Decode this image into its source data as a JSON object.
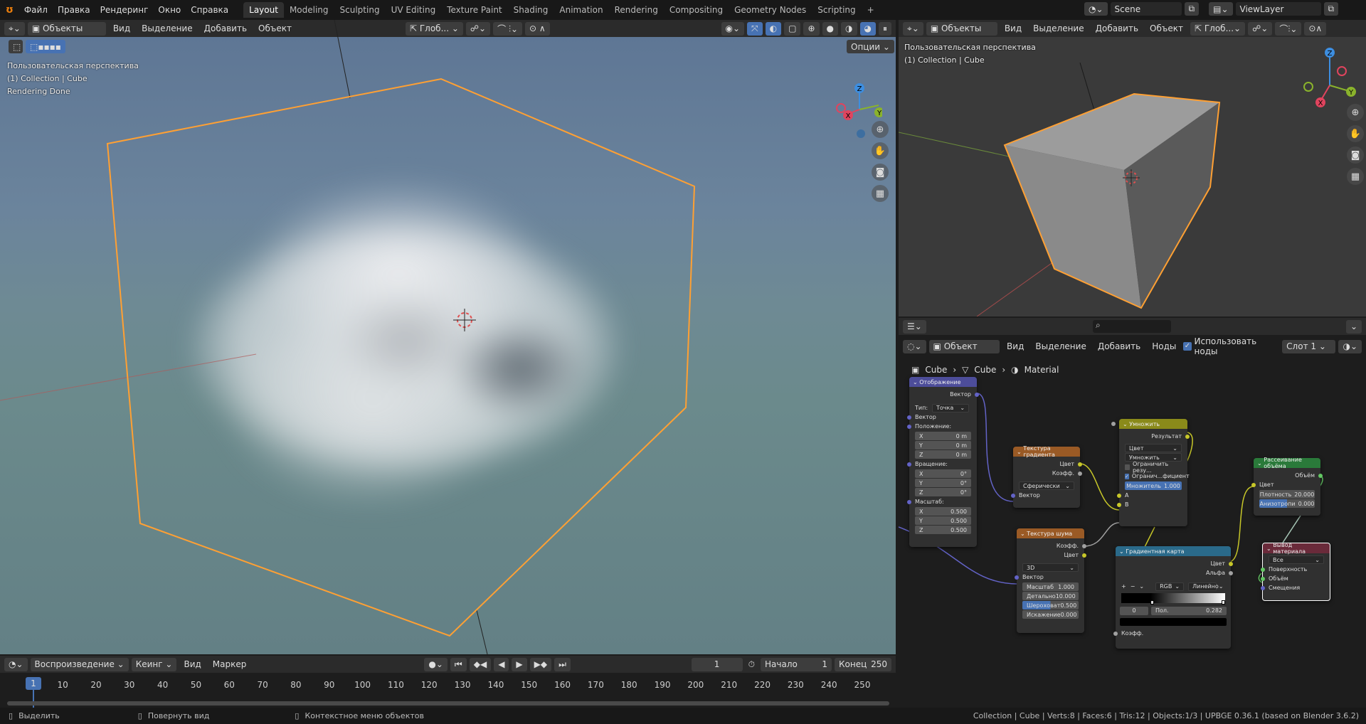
{
  "topbar": {
    "menus": [
      "Файл",
      "Правка",
      "Рендеринг",
      "Окно",
      "Справка"
    ],
    "workspaces": [
      "Layout",
      "Modeling",
      "Sculpting",
      "UV Editing",
      "Texture Paint",
      "Shading",
      "Animation",
      "Rendering",
      "Compositing",
      "Geometry Nodes",
      "Scripting"
    ],
    "active_workspace": "Layout",
    "add_workspace": "+",
    "scene": "Scene",
    "view_layer": "ViewLayer"
  },
  "viewport_left": {
    "mode": "Объекты",
    "menus": [
      "Вид",
      "Выделение",
      "Добавить",
      "Объект"
    ],
    "transform_orientation": "Глоб...",
    "options": "Опции",
    "info": [
      "Пользовательская перспектива",
      "(1) Collection | Cube",
      "Rendering Done"
    ],
    "axes": {
      "x": "X",
      "y": "Y",
      "z": "Z"
    },
    "shading": "rendered"
  },
  "viewport_right": {
    "mode": "Объекты",
    "menus": [
      "Вид",
      "Выделение",
      "Добавить",
      "Объект"
    ],
    "transform_orientation": "Глоб...",
    "info": [
      "Пользовательская перспектива",
      "(1) Collection | Cube"
    ],
    "axes": {
      "x": "X",
      "y": "Y",
      "z": "Z"
    }
  },
  "properties_strip": {
    "search_placeholder": ""
  },
  "node_editor": {
    "object_mode": "Объект",
    "menus": [
      "Вид",
      "Выделение",
      "Добавить",
      "Ноды"
    ],
    "use_nodes_label": "Использовать ноды",
    "use_nodes": true,
    "slot": "Слот 1",
    "breadcrumb": [
      "Cube",
      "Cube",
      "Material"
    ],
    "nodes": {
      "mapping": {
        "title": "Отображение",
        "out_vector": "Вектор",
        "type_label": "Тип:",
        "type_value": "Точка",
        "in_vector": "Вектор",
        "location": "Положение:",
        "loc": [
          [
            "X",
            "0 m"
          ],
          [
            "Y",
            "0 m"
          ],
          [
            "Z",
            "0 m"
          ]
        ],
        "rotation": "Вращение:",
        "rot": [
          [
            "X",
            "0°"
          ],
          [
            "Y",
            "0°"
          ],
          [
            "Z",
            "0°"
          ]
        ],
        "scale": "Масштаб:",
        "scl": [
          [
            "X",
            "0.500"
          ],
          [
            "Y",
            "0.500"
          ],
          [
            "Z",
            "0.500"
          ]
        ]
      },
      "gradient_tex": {
        "title": "Текстура градиента",
        "out_color": "Цвет",
        "out_fac": "Коэфф.",
        "type": "Сферически",
        "in_vector": "Вектор"
      },
      "noise_tex": {
        "title": "Текстура шума",
        "out_fac": "Коэфф.",
        "out_color": "Цвет",
        "dims": "3D",
        "in_vector": "Вектор",
        "fields": [
          [
            "Масштаб",
            "1.000"
          ],
          [
            "Детально",
            "10.000"
          ],
          [
            "Шероховат",
            "0.500"
          ],
          [
            "Искажение",
            "0.000"
          ]
        ]
      },
      "multiply": {
        "title": "Умножить",
        "out_result": "Результат",
        "data_type": "Цвет",
        "blend": "Умножить",
        "clamp_result": "Ограничить резу...",
        "clamp_result_on": false,
        "clamp_factor": "Огранич...фициент",
        "clamp_factor_on": true,
        "factor_label": "Множитель",
        "factor_value": "1.000",
        "in_a": "A",
        "in_b": "B"
      },
      "color_ramp": {
        "title": "Градиентная карта",
        "out_color": "Цвет",
        "out_alpha": "Альфа",
        "add": "+",
        "remove": "−",
        "color_mode": "RGB",
        "interpolation": "Линейно",
        "stop_index": "0",
        "pos_label": "Пол.",
        "pos_value": "0.282",
        "in_fac": "Коэфф."
      },
      "volume_scatter": {
        "title": "Рассеивание объёма",
        "out_volume": "Объём",
        "in_color": "Цвет",
        "density_label": "Плотность",
        "density": "20.000",
        "aniso_label": "Анизотропи",
        "aniso": "0.000"
      },
      "material_output": {
        "title": "Вывод материала",
        "target": "Все",
        "surface": "Поверхность",
        "volume": "Объём",
        "displacement": "Смещения"
      }
    }
  },
  "timeline": {
    "menus": [
      "Воспроизведение",
      "Кеинг",
      "Вид",
      "Маркер"
    ],
    "current_frame": "1",
    "start_label": "Начало",
    "start": "1",
    "end_label": "Конец",
    "end": "250",
    "ticks": [
      "10",
      "20",
      "30",
      "40",
      "50",
      "60",
      "70",
      "80",
      "90",
      "100",
      "110",
      "120",
      "130",
      "140",
      "150",
      "160",
      "170",
      "180",
      "190",
      "200",
      "210",
      "220",
      "230",
      "240",
      "250"
    ]
  },
  "statusbar": {
    "hints": [
      "Выделить",
      "Повернуть вид",
      "Контекстное меню объектов"
    ],
    "stats": "Collection | Cube | Verts:8 | Faces:6 | Tris:12 | Objects:1/3 | UPBGE 0.36.1 (based on Blender 3.6.2)"
  },
  "colors": {
    "accent": "#4772b3",
    "selection": "#ffa033",
    "bg": "#1d1d1d"
  }
}
